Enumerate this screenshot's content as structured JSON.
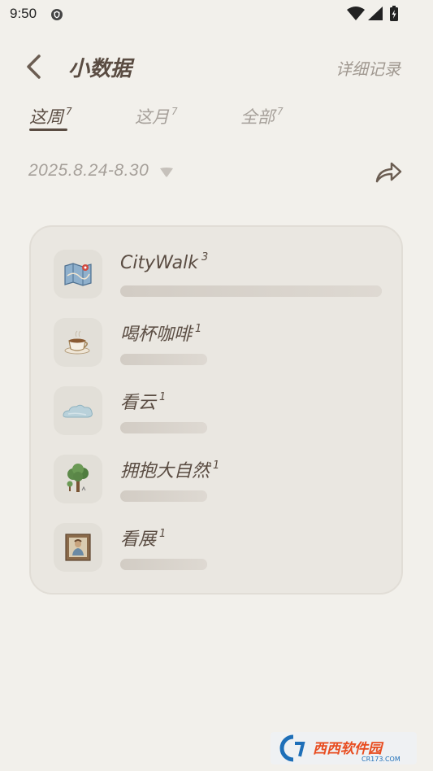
{
  "status_bar": {
    "time": "9:50"
  },
  "header": {
    "title": "小数据",
    "detail_link": "详细记录"
  },
  "tabs": [
    {
      "label": "这周",
      "count": "7",
      "active": true
    },
    {
      "label": "这月",
      "count": "7",
      "active": false
    },
    {
      "label": "全部",
      "count": "7",
      "active": false
    }
  ],
  "date_range": "2025.8.24-8.30",
  "items": [
    {
      "label": "CityWalk",
      "count": "3",
      "icon": "map-icon",
      "fraction": 1.0
    },
    {
      "label": "喝杯咖啡",
      "count": "1",
      "icon": "coffee-icon",
      "fraction": 0.333
    },
    {
      "label": "看云",
      "count": "1",
      "icon": "cloud-icon",
      "fraction": 0.333
    },
    {
      "label": "拥抱大自然",
      "count": "1",
      "icon": "tree-icon",
      "fraction": 0.333
    },
    {
      "label": "看展",
      "count": "1",
      "icon": "framed-picture-icon",
      "fraction": 0.333
    }
  ],
  "watermark": {
    "text": "西西软件园",
    "sub": "CR173.COM"
  },
  "colors": {
    "background": "#f2f0eb",
    "text_dark": "#5a4c42",
    "text_muted": "#a6a09a",
    "card": "#eae7e1"
  }
}
